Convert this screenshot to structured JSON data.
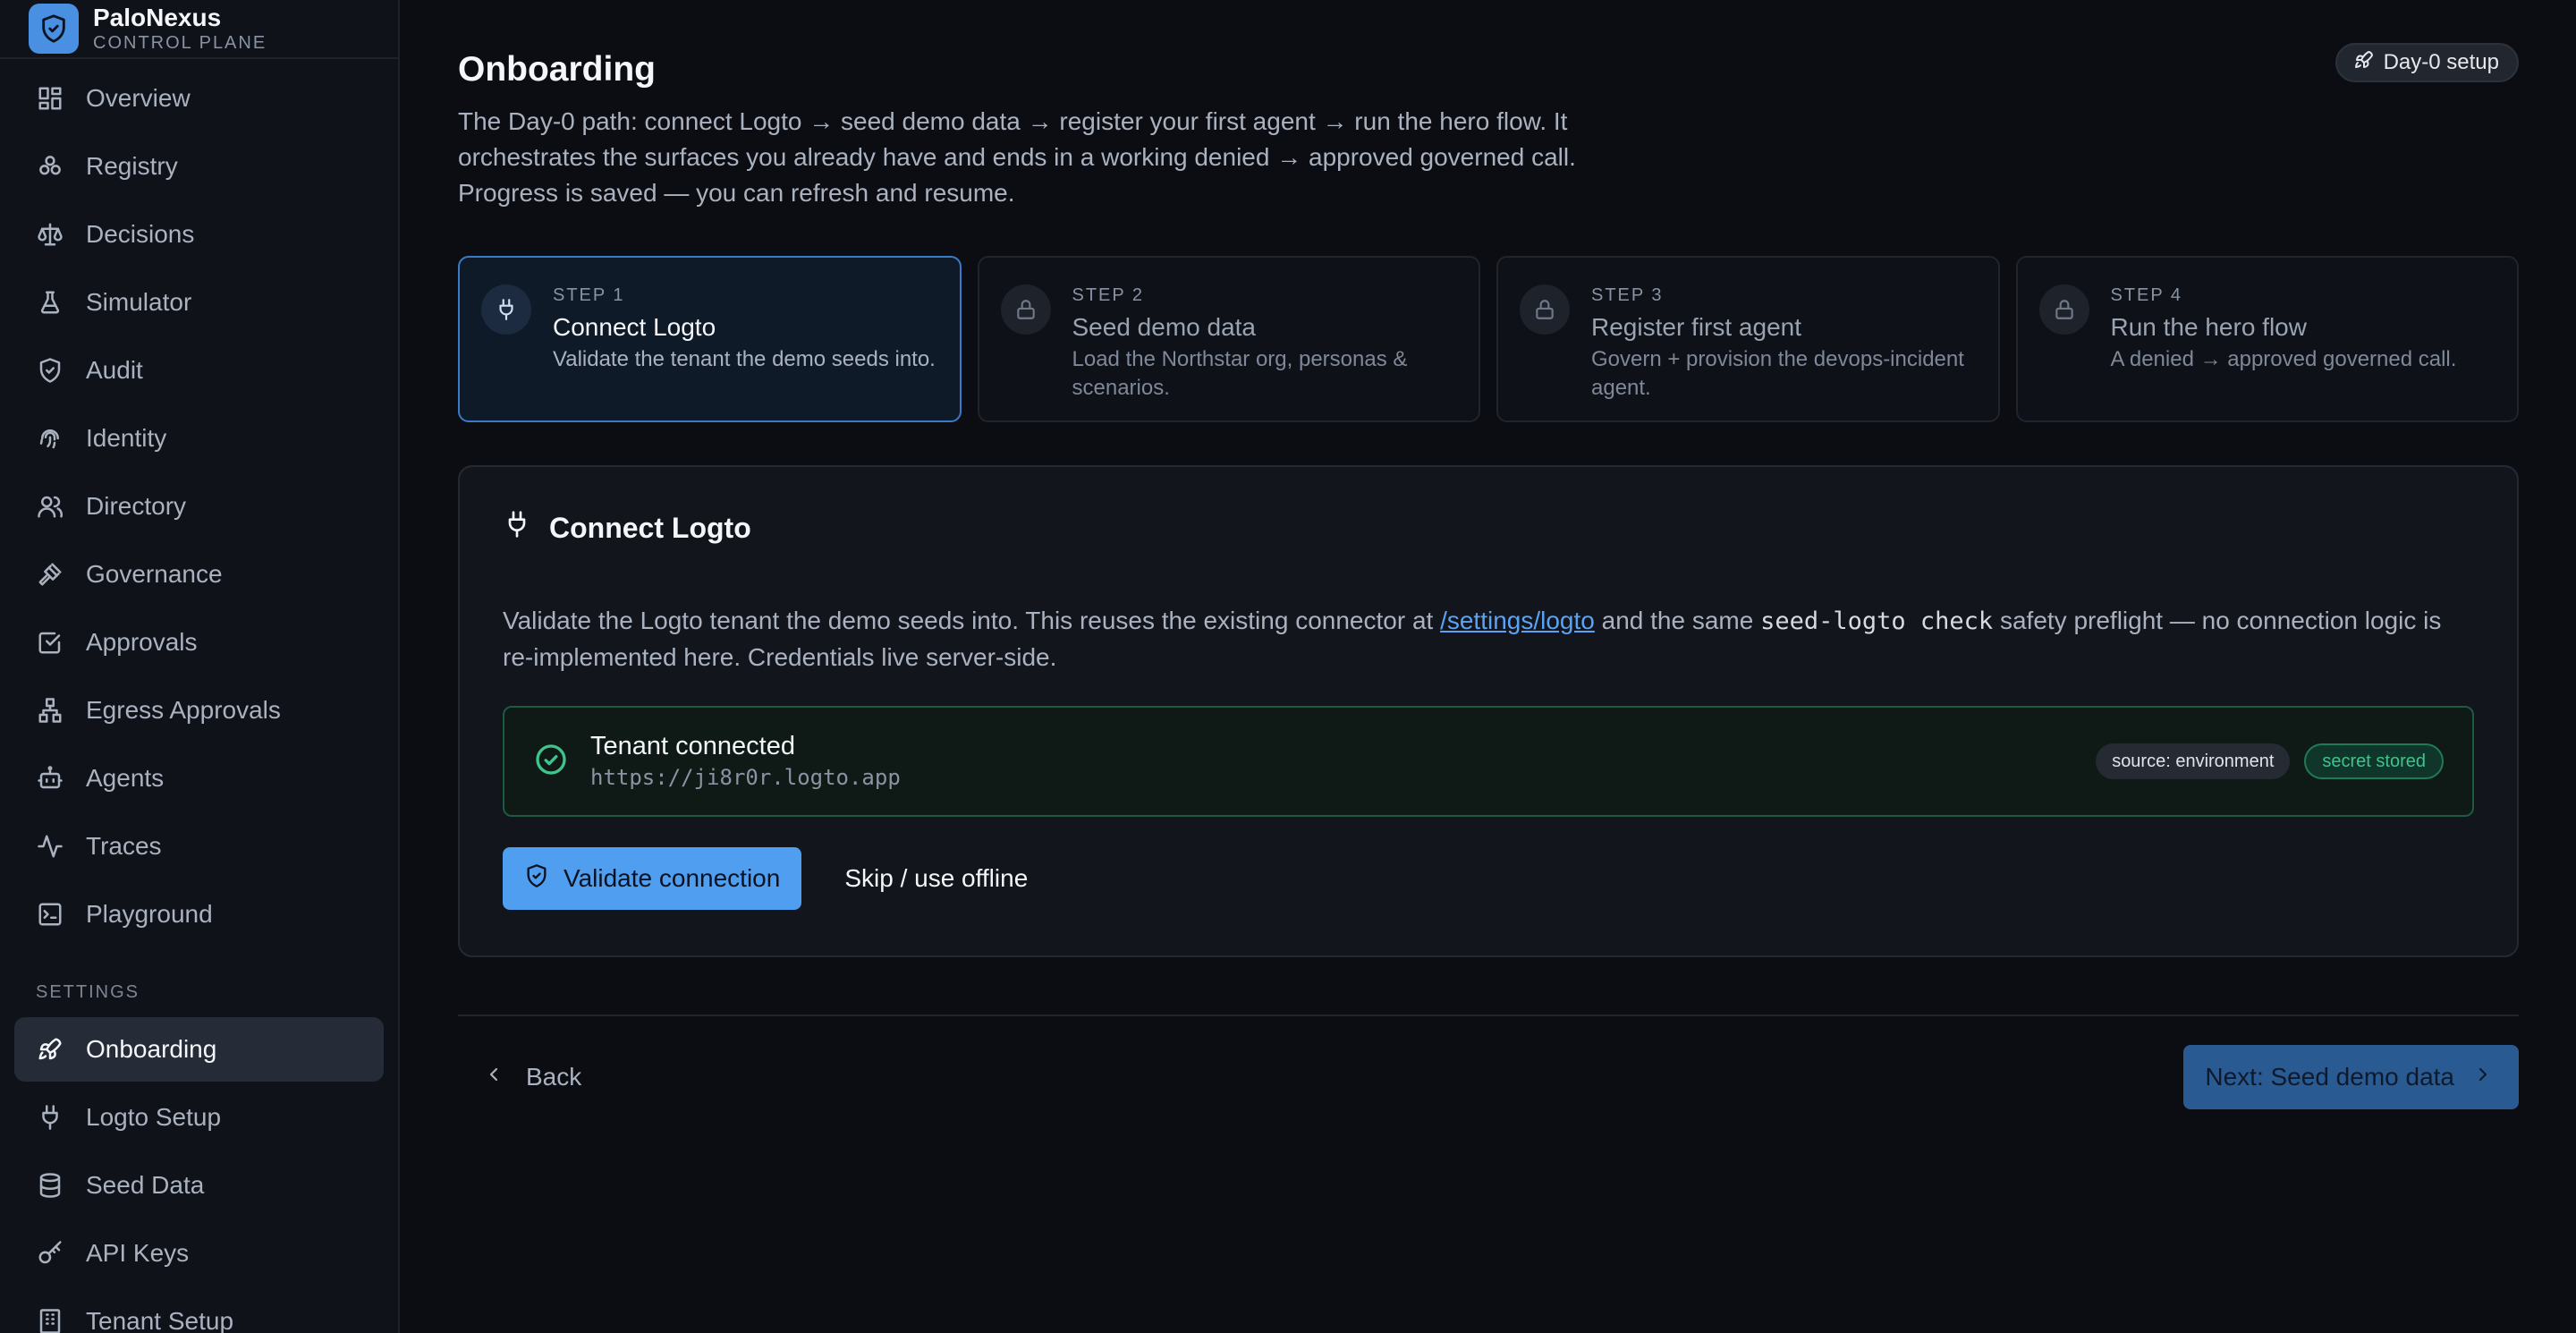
{
  "brand": {
    "name": "PaloNexus",
    "subtitle": "CONTROL PLANE"
  },
  "sidebar": {
    "items": [
      {
        "label": "Overview",
        "icon": "grid-icon"
      },
      {
        "label": "Registry",
        "icon": "registry-icon"
      },
      {
        "label": "Decisions",
        "icon": "scale-icon"
      },
      {
        "label": "Simulator",
        "icon": "flask-icon"
      },
      {
        "label": "Audit",
        "icon": "shield-check-icon"
      },
      {
        "label": "Identity",
        "icon": "fingerprint-icon"
      },
      {
        "label": "Directory",
        "icon": "users-icon"
      },
      {
        "label": "Governance",
        "icon": "gavel-icon"
      },
      {
        "label": "Approvals",
        "icon": "check-square-icon"
      },
      {
        "label": "Egress Approvals",
        "icon": "network-icon"
      },
      {
        "label": "Agents",
        "icon": "bot-icon"
      },
      {
        "label": "Traces",
        "icon": "activity-icon"
      },
      {
        "label": "Playground",
        "icon": "terminal-icon"
      }
    ],
    "settings_label": "SETTINGS",
    "settings_items": [
      {
        "label": "Onboarding",
        "icon": "rocket-icon",
        "active": true
      },
      {
        "label": "Logto Setup",
        "icon": "plug-icon"
      },
      {
        "label": "Seed Data",
        "icon": "database-icon"
      },
      {
        "label": "API Keys",
        "icon": "key-icon"
      },
      {
        "label": "Tenant Setup",
        "icon": "building-icon"
      }
    ]
  },
  "header": {
    "title": "Onboarding",
    "description": "The Day-0 path: connect Logto → seed demo data → register your first agent → run the hero flow. It orchestrates the surfaces you already have and ends in a working denied → approved governed call. Progress is saved — you can refresh and resume.",
    "badge": "Day-0 setup"
  },
  "steps": [
    {
      "num": "STEP 1",
      "title": "Connect Logto",
      "desc": "Validate the tenant the demo seeds into.",
      "icon": "plug-icon",
      "active": true
    },
    {
      "num": "STEP 2",
      "title": "Seed demo data",
      "desc": "Load the Northstar org, personas & scenarios.",
      "icon": "lock-icon",
      "active": false
    },
    {
      "num": "STEP 3",
      "title": "Register first agent",
      "desc": "Govern + provision the devops-incident agent.",
      "icon": "lock-icon",
      "active": false
    },
    {
      "num": "STEP 4",
      "title": "Run the hero flow",
      "desc": "A denied → approved governed call.",
      "icon": "lock-icon",
      "active": false
    }
  ],
  "card": {
    "title": "Connect Logto",
    "desc_pre": "Validate the Logto tenant the demo seeds into. This reuses the existing connector at ",
    "desc_link": "/settings/logto",
    "desc_mid": " and the same ",
    "desc_code": "seed-logto check",
    "desc_post": " safety preflight — no connection logic is re-implemented here. Credentials live server-side.",
    "status_title": "Tenant connected",
    "status_url": "https://ji8r0r.logto.app",
    "badge_source": "source: environment",
    "badge_secret": "secret stored",
    "validate_label": "Validate connection",
    "skip_label": "Skip / use offline"
  },
  "footer": {
    "back_label": "Back",
    "next_label": "Next: Seed demo data"
  }
}
